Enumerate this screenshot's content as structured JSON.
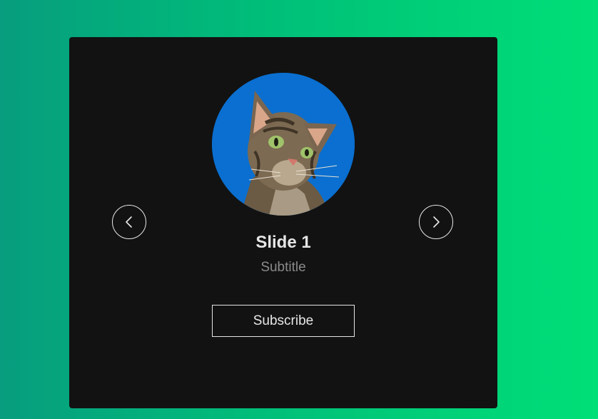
{
  "slide": {
    "title": "Slide 1",
    "subtitle": "Subtitle",
    "image_subject": "cat-photo"
  },
  "controls": {
    "prev_icon": "chevron-left-icon",
    "next_icon": "chevron-right-icon",
    "subscribe_label": "Subscribe"
  },
  "colors": {
    "background_gradient_start": "#079d7e",
    "background_gradient_end": "#00df77",
    "card": "#121212",
    "title_text": "#e6e6e6",
    "subtitle_text": "#8a8a8a",
    "avatar_background": "#0a6fd0"
  }
}
